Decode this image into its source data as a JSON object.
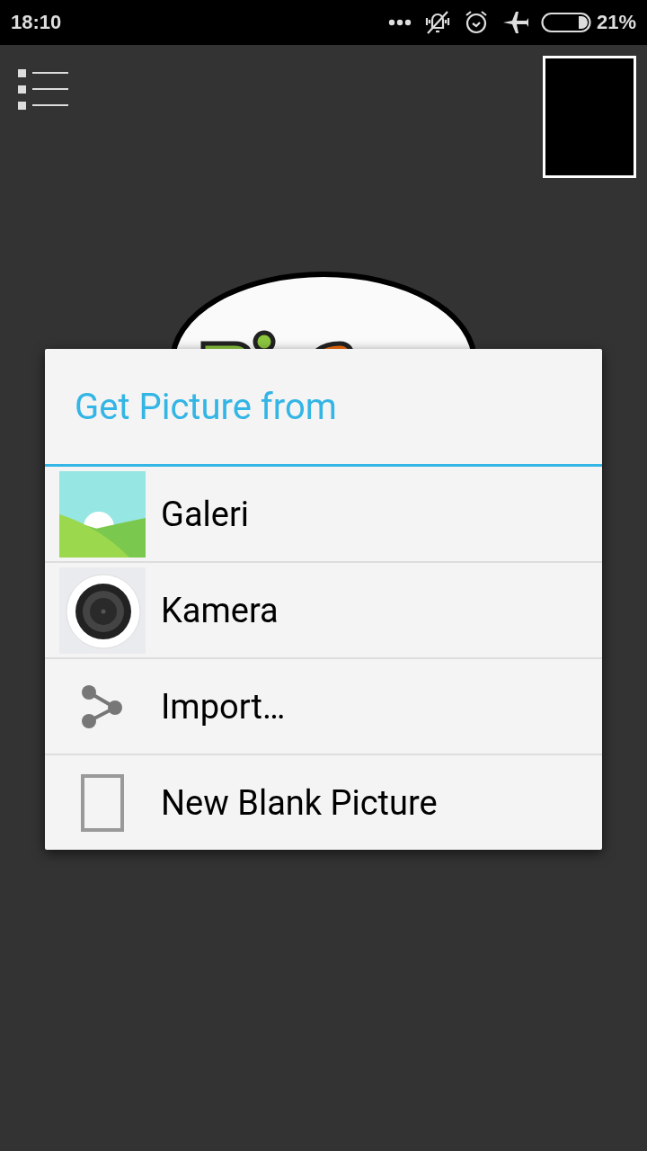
{
  "status_bar": {
    "time": "18:10",
    "battery_percent": "21%"
  },
  "dialog": {
    "title": "Get Picture from",
    "items": [
      {
        "kind": "gallery",
        "label": "Galeri"
      },
      {
        "kind": "camera",
        "label": "Kamera"
      },
      {
        "kind": "share",
        "label": "Import…"
      },
      {
        "kind": "blank",
        "label": "New Blank Picture"
      }
    ]
  }
}
